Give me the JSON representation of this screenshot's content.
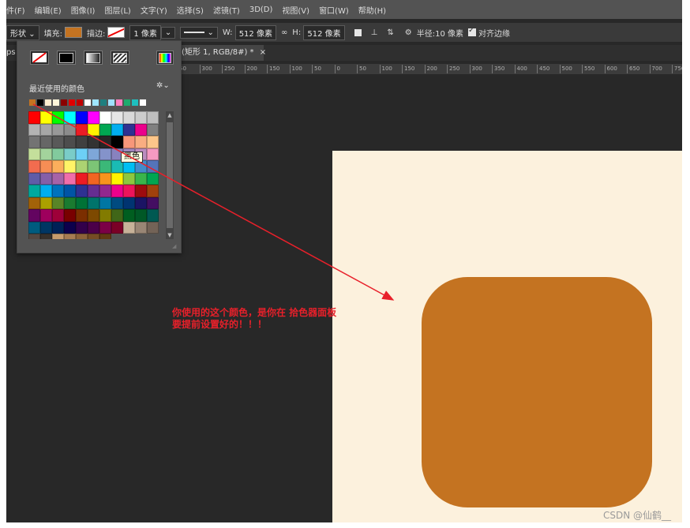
{
  "menu": [
    "件(F)",
    "编辑(E)",
    "图像(I)",
    "图层(L)",
    "文字(Y)",
    "选择(S)",
    "滤镜(T)",
    "3D(D)",
    "视图(V)",
    "窗口(W)",
    "帮助(H)"
  ],
  "options": {
    "mode": "形状",
    "fill_label": "填充:",
    "fill_color": "#c47321",
    "stroke_label": "描边:",
    "stroke_width": "1 像素",
    "w_label": "W:",
    "w_value": "512 像素",
    "link": "∞",
    "h_label": "H:",
    "h_value": "512 像素",
    "radius_label": "半径:",
    "radius_value": "10 像素",
    "align_edges": "对齐边缘"
  },
  "tabs": {
    "left_fragment": "ps",
    "doc_tab": "(矩形 1, RGB/8#) *",
    "close": "×"
  },
  "ruler_ticks": [
    "50",
    "300",
    "250",
    "200",
    "150",
    "100",
    "50",
    "0",
    "50",
    "100",
    "150",
    "200",
    "250",
    "300",
    "350",
    "400",
    "450",
    "500",
    "550",
    "600",
    "650",
    "700",
    "750"
  ],
  "swatch_panel": {
    "recent_label": "最近使用的颜色",
    "recent_colors": [
      "#c47321",
      "#000000",
      "#fdeed0",
      "#fff6da",
      "#8b0000",
      "#e00000",
      "#c00000",
      "#ffffff",
      "#9fe5ff",
      "#1f7f7f",
      "#a0e0ff",
      "#ff80c0",
      "#1faa6e",
      "#1fbfbf",
      "#ffffff"
    ],
    "tooltip": "黑色",
    "grid_colors": [
      "#ff0000",
      "#ffff00",
      "#00ff00",
      "#00ffff",
      "#0000ff",
      "#ff00ff",
      "#ffffff",
      "#e6e6e6",
      "#d9d9d9",
      "#cccccc",
      "#bfbfbf",
      "#b3b3b3",
      "#a6a6a6",
      "#999999",
      "#8c8c8c",
      "#ed1c24",
      "#fff200",
      "#00a651",
      "#00aeef",
      "#2e3192",
      "#ec008c",
      "#808080",
      "#737373",
      "#666666",
      "#595959",
      "#4d4d4d",
      "#404040",
      "#333333",
      "#262626",
      "#000000",
      "#f7977a",
      "#f9ad81",
      "#fdc68a",
      "#c4df9b",
      "#a3d39c",
      "#82ca9d",
      "#7accc8",
      "#6dcff6",
      "#7ea7d8",
      "#8493ca",
      "#8882be",
      "#a187be",
      "#bc8dbf",
      "#f49ac2",
      "#f26c4f",
      "#f68e55",
      "#fbaf5c",
      "#fff467",
      "#acd372",
      "#7cc576",
      "#3bb878",
      "#1abbb4",
      "#00bff3",
      "#438ccb",
      "#5574b9",
      "#605ca8",
      "#855fa8",
      "#a763a8",
      "#f06eaa",
      "#ed1c24",
      "#f26522",
      "#f7941d",
      "#fff200",
      "#8dc73f",
      "#39b54a",
      "#00a651",
      "#00a99d",
      "#00aeef",
      "#0072bc",
      "#0054a6",
      "#2e3192",
      "#662d91",
      "#92278f",
      "#ec008c",
      "#ed145b",
      "#9e0b0f",
      "#a0410d",
      "#a36209",
      "#aba000",
      "#598527",
      "#1a7b30",
      "#007236",
      "#00746b",
      "#0076a3",
      "#004b80",
      "#003471",
      "#1b1464",
      "#440e62",
      "#630460",
      "#9e005d",
      "#9e0039",
      "#790000",
      "#7b2e00",
      "#7d4900",
      "#827b00",
      "#406618",
      "#005e20",
      "#005826",
      "#005952",
      "#005b7f",
      "#003663",
      "#002157",
      "#0d004c",
      "#32004b",
      "#4b0049",
      "#7b0046",
      "#7a0026",
      "#c7b299",
      "#998675",
      "#736357",
      "#534741",
      "#37302a",
      "#c69c6d",
      "#a67c52",
      "#8c6239",
      "#754c24",
      "#603913"
    ]
  },
  "annotation": {
    "line1": "你使用的这个颜色，是你在 拾色器面板",
    "line2": "要提前设置好的！！！",
    "color": "#e8202a"
  },
  "canvas": {
    "background": "#fcf1dd",
    "shape_color": "#c47321"
  },
  "watermark": "CSDN @仙鹤__"
}
